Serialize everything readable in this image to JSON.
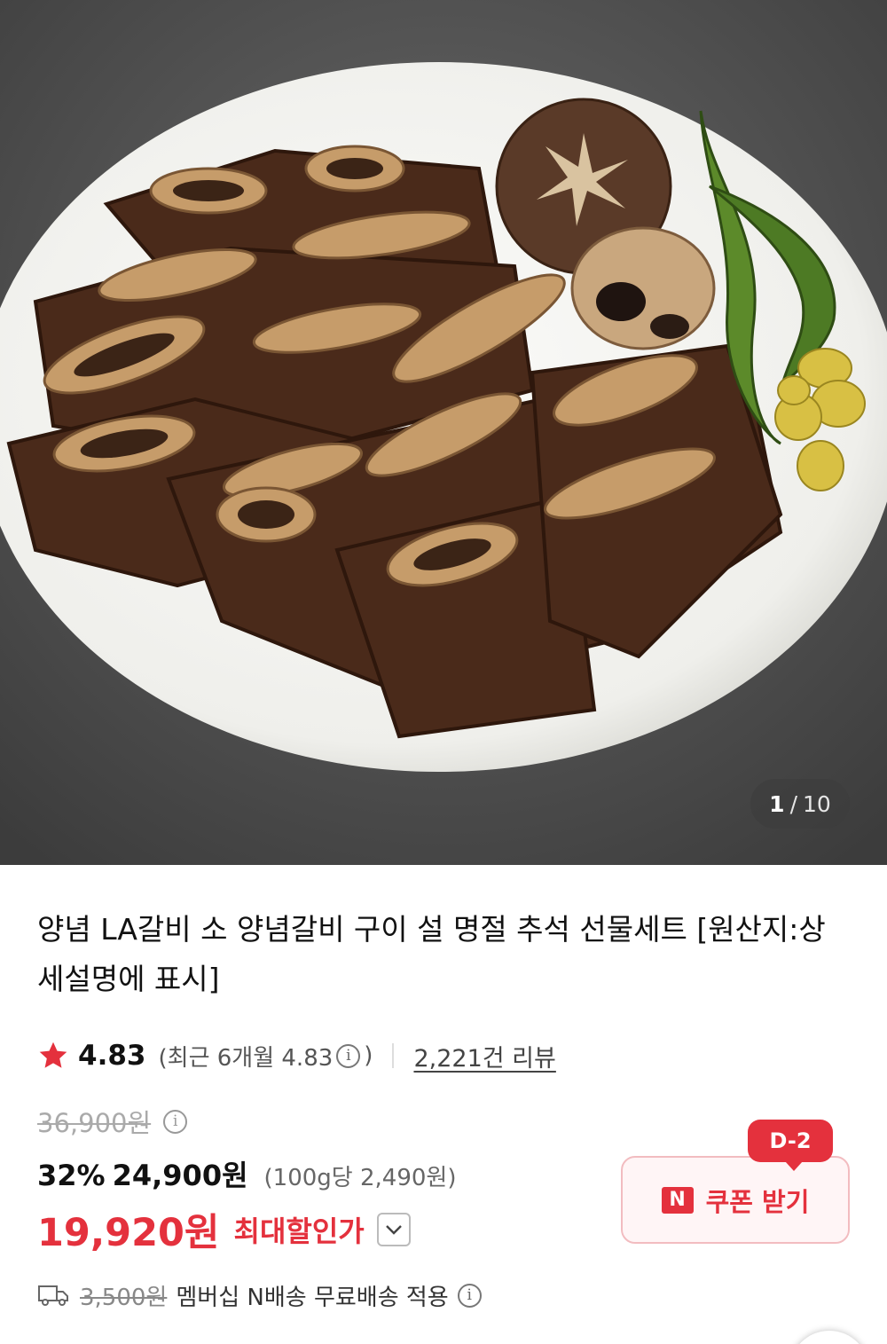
{
  "gallery": {
    "current": "1",
    "separator": "/",
    "total": "10"
  },
  "product": {
    "title": "양념 LA갈비 소 양념갈비 구이 설 명절 추석 선물세트 [원산지:상세설명에 표시]"
  },
  "rating": {
    "score": "4.83",
    "recent_prefix": "(최근 6개월 4.83",
    "recent_suffix": ")",
    "info_icon": "i",
    "reviews_link": "2,221건 리뷰"
  },
  "price": {
    "original": "36,900원",
    "discount": "32%",
    "sale": "24,900원",
    "per_unit": "(100g당 2,490원)",
    "best": "19,920원",
    "best_label": "최대할인가"
  },
  "coupon": {
    "badge": "D-2",
    "n_logo": "N",
    "label": "쿠폰 받기"
  },
  "shipping": {
    "fee": "3,500원",
    "text": "멤버십 N배송 무료배송 적용"
  },
  "colors": {
    "accent": "#e4313d",
    "coupon_bg": "#fff5f6",
    "muted": "#aaaaaa"
  },
  "icons": [
    "star-icon",
    "info-icon",
    "chevron-down-icon",
    "truck-icon",
    "naver-n-icon"
  ]
}
